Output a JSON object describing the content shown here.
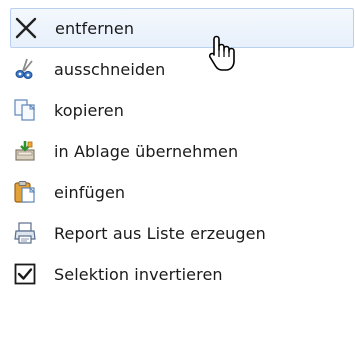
{
  "menu": {
    "items": [
      {
        "label": "entfernen",
        "icon": "close-x-icon"
      },
      {
        "label": "ausschneiden",
        "icon": "scissors-icon"
      },
      {
        "label": "kopieren",
        "icon": "copy-icon"
      },
      {
        "label": "in Ablage übernehmen",
        "icon": "add-to-clipboard-icon"
      },
      {
        "label": "einfügen",
        "icon": "paste-icon"
      },
      {
        "label": "Report aus Liste erzeugen",
        "icon": "printer-icon"
      },
      {
        "label": "Selektion invertieren",
        "icon": "checkbox-checked-icon"
      }
    ],
    "hovered_index": 0
  },
  "colors": {
    "hover_background": "#e7f0fb",
    "hover_border": "#b9d1ee",
    "text": "#1a1a1a"
  }
}
